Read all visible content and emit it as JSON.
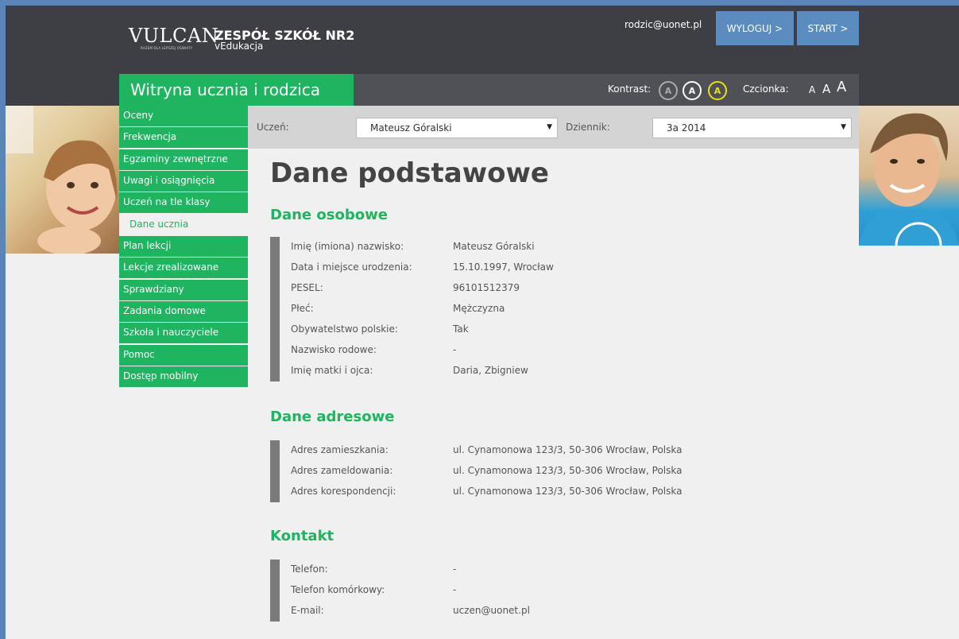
{
  "header": {
    "logo": "VULCAN",
    "logo_tagline": "RAZEM DLA LEPSZEJ OŚWIATY",
    "school_name": "ZESPÓŁ SZKÓŁ NR2",
    "school_subtitle": "vEdukacja",
    "user_email": "rodzic@uonet.pl",
    "logout_label": "WYLOGUJ >",
    "start_label": "START >"
  },
  "titlebar": {
    "site_title": "Witryna ucznia i rodzica",
    "contrast_label": "Kontrast:",
    "contrast_options": [
      "A",
      "A",
      "A"
    ],
    "font_label": "Czcionka:",
    "font_options": [
      "A",
      "A",
      "A"
    ]
  },
  "sidebar": {
    "items": [
      {
        "label": "Oceny",
        "active": false
      },
      {
        "label": "Frekwencja",
        "active": false
      },
      {
        "label": "Egzaminy zewnętrzne",
        "active": false
      },
      {
        "label": "Uwagi i osiągnięcia",
        "active": false
      },
      {
        "label": "Uczeń na tle klasy",
        "active": false
      },
      {
        "label": "Dane ucznia",
        "active": true
      },
      {
        "label": "Plan lekcji",
        "active": false
      },
      {
        "label": "Lekcje zrealizowane",
        "active": false
      },
      {
        "label": "Sprawdziany",
        "active": false
      },
      {
        "label": "Zadania domowe",
        "active": false
      },
      {
        "label": "Szkoła i nauczyciele",
        "active": false
      },
      {
        "label": "Pomoc",
        "active": false
      },
      {
        "label": "Dostęp mobilny",
        "active": false
      }
    ]
  },
  "selectors": {
    "student_label": "Uczeń:",
    "student_value": "Mateusz Góralski",
    "journal_label": "Dziennik:",
    "journal_value": "3a 2014"
  },
  "main": {
    "title": "Dane podstawowe",
    "sections": [
      {
        "title": "Dane osobowe",
        "rows": [
          {
            "label": "Imię (imiona) nazwisko:",
            "value": "Mateusz Góralski"
          },
          {
            "label": "Data i miejsce urodzenia:",
            "value": "15.10.1997, Wrocław"
          },
          {
            "label": "PESEL:",
            "value": "96101512379"
          },
          {
            "label": "Płeć:",
            "value": "Mężczyzna"
          },
          {
            "label": "Obywatelstwo polskie:",
            "value": "Tak"
          },
          {
            "label": "Nazwisko rodowe:",
            "value": "-"
          },
          {
            "label": "Imię matki i ojca:",
            "value": "Daria, Zbigniew"
          }
        ]
      },
      {
        "title": "Dane adresowe",
        "rows": [
          {
            "label": "Adres zamieszkania:",
            "value": "ul. Cynamonowa 123/3, 50-306 Wrocław, Polska"
          },
          {
            "label": "Adres zameldowania:",
            "value": "ul. Cynamonowa 123/3, 50-306 Wrocław, Polska"
          },
          {
            "label": "Adres korespondencji:",
            "value": "ul. Cynamonowa 123/3, 50-306 Wrocław, Polska"
          }
        ]
      },
      {
        "title": "Kontakt",
        "rows": [
          {
            "label": "Telefon:",
            "value": "-"
          },
          {
            "label": "Telefon komórkowy:",
            "value": "-"
          },
          {
            "label": "E-mail:",
            "value": "uczen@uonet.pl"
          }
        ]
      }
    ]
  },
  "colors": {
    "accent_green": "#1fb45f",
    "header_dark": "#3e3f45",
    "button_blue": "#5a8cbf",
    "contrast_yellow": "#e8e300"
  }
}
